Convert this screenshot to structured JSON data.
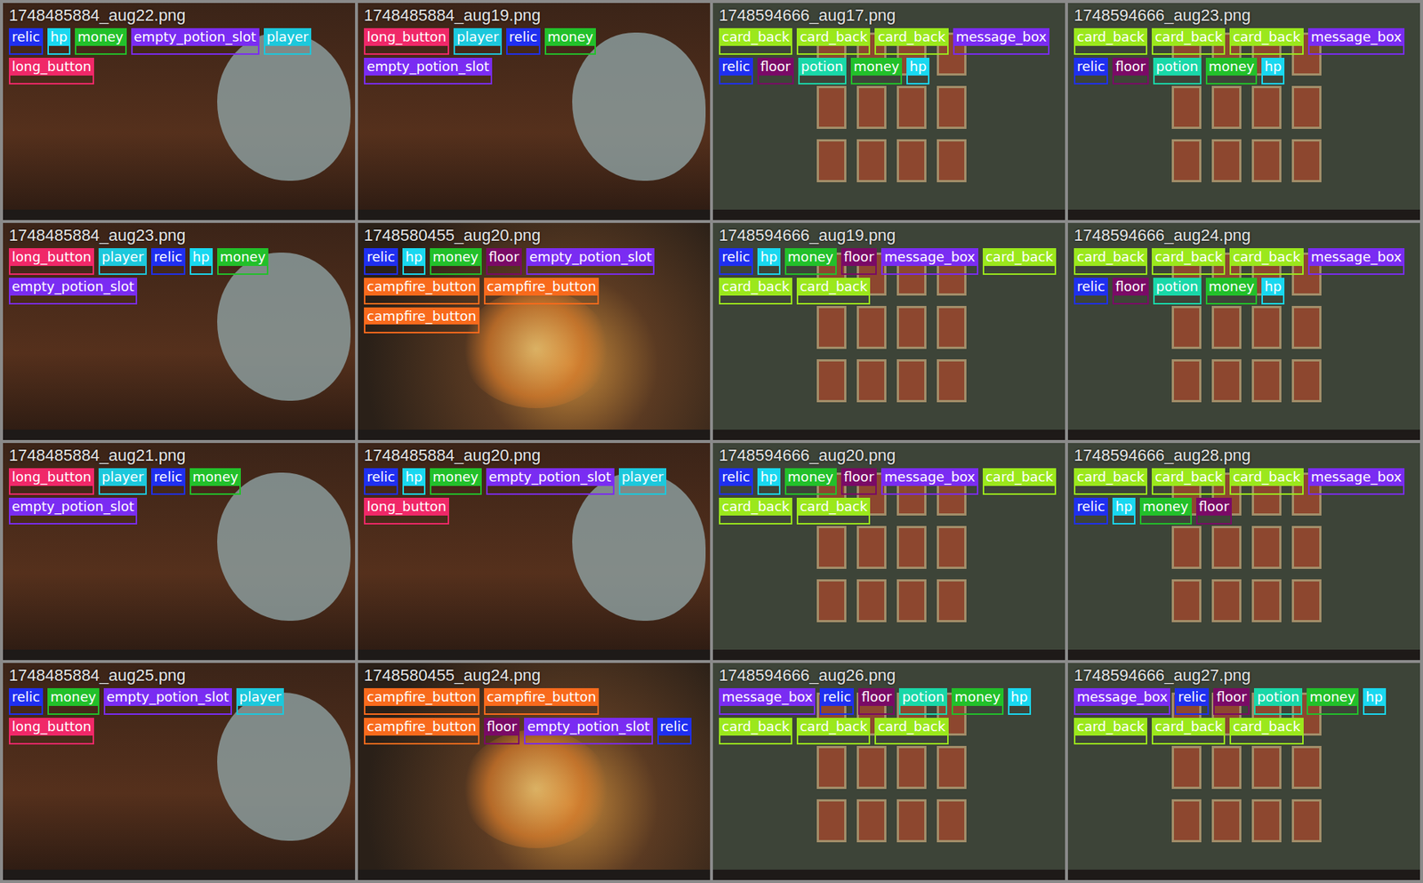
{
  "mosaic": {
    "tiles": [
      {
        "file": "1748485884_aug22.png",
        "kind": "blob",
        "labels": [
          {
            "text": "relic",
            "color": "#1f2ff0"
          },
          {
            "text": "hp",
            "color": "#19d8f0"
          },
          {
            "text": "money",
            "color": "#22c02a"
          },
          {
            "text": "empty_potion_slot",
            "color": "#7a2cf2"
          },
          {
            "text": "player",
            "color": "#1cc8dc"
          },
          {
            "text": "long_button",
            "color": "#f02868"
          }
        ]
      },
      {
        "file": "1748485884_aug19.png",
        "kind": "blob",
        "labels": [
          {
            "text": "long_button",
            "color": "#f02868"
          },
          {
            "text": "player",
            "color": "#1cc8dc"
          },
          {
            "text": "relic",
            "color": "#1f2ff0"
          },
          {
            "text": "money",
            "color": "#22c02a"
          },
          {
            "text": "empty_potion_slot",
            "color": "#7a2cf2"
          }
        ]
      },
      {
        "file": "1748594666_aug17.png",
        "kind": "cards",
        "labels": [
          {
            "text": "card_back",
            "color": "#9be81c"
          },
          {
            "text": "card_back",
            "color": "#9be81c"
          },
          {
            "text": "card_back",
            "color": "#9be81c"
          },
          {
            "text": "message_box",
            "color": "#7a2cf2"
          },
          {
            "text": "relic",
            "color": "#1f2ff0"
          },
          {
            "text": "floor",
            "color": "#7a0a66"
          },
          {
            "text": "potion",
            "color": "#19d8a8"
          },
          {
            "text": "money",
            "color": "#22c02a"
          },
          {
            "text": "hp",
            "color": "#19d8f0"
          }
        ]
      },
      {
        "file": "1748594666_aug23.png",
        "kind": "cards",
        "labels": [
          {
            "text": "card_back",
            "color": "#9be81c"
          },
          {
            "text": "card_back",
            "color": "#9be81c"
          },
          {
            "text": "card_back",
            "color": "#9be81c"
          },
          {
            "text": "message_box",
            "color": "#7a2cf2"
          },
          {
            "text": "relic",
            "color": "#1f2ff0"
          },
          {
            "text": "floor",
            "color": "#7a0a66"
          },
          {
            "text": "potion",
            "color": "#19d8a8"
          },
          {
            "text": "money",
            "color": "#22c02a"
          },
          {
            "text": "hp",
            "color": "#19d8f0"
          }
        ]
      },
      {
        "file": "1748485884_aug23.png",
        "kind": "blob",
        "labels": [
          {
            "text": "long_button",
            "color": "#f02868"
          },
          {
            "text": "player",
            "color": "#1cc8dc"
          },
          {
            "text": "relic",
            "color": "#1f2ff0"
          },
          {
            "text": "hp",
            "color": "#19d8f0"
          },
          {
            "text": "money",
            "color": "#22c02a"
          },
          {
            "text": "empty_potion_slot",
            "color": "#7a2cf2"
          }
        ]
      },
      {
        "file": "1748580455_aug20.png",
        "kind": "campfire",
        "labels": [
          {
            "text": "relic",
            "color": "#1f2ff0"
          },
          {
            "text": "hp",
            "color": "#19d8f0"
          },
          {
            "text": "money",
            "color": "#22c02a"
          },
          {
            "text": "floor",
            "color": "#7a0a66"
          },
          {
            "text": "empty_potion_slot",
            "color": "#7a2cf2"
          },
          {
            "text": "campfire_button",
            "color": "#f86a1c"
          },
          {
            "text": "campfire_button",
            "color": "#f86a1c"
          },
          {
            "text": "campfire_button",
            "color": "#f86a1c"
          }
        ]
      },
      {
        "file": "1748594666_aug19.png",
        "kind": "cards",
        "labels": [
          {
            "text": "relic",
            "color": "#1f2ff0"
          },
          {
            "text": "hp",
            "color": "#19d8f0"
          },
          {
            "text": "money",
            "color": "#22c02a"
          },
          {
            "text": "floor",
            "color": "#7a0a66"
          },
          {
            "text": "message_box",
            "color": "#7a2cf2"
          },
          {
            "text": "card_back",
            "color": "#9be81c"
          },
          {
            "text": "card_back",
            "color": "#9be81c"
          },
          {
            "text": "card_back",
            "color": "#9be81c"
          }
        ]
      },
      {
        "file": "1748594666_aug24.png",
        "kind": "cards",
        "labels": [
          {
            "text": "card_back",
            "color": "#9be81c"
          },
          {
            "text": "card_back",
            "color": "#9be81c"
          },
          {
            "text": "card_back",
            "color": "#9be81c"
          },
          {
            "text": "message_box",
            "color": "#7a2cf2"
          },
          {
            "text": "relic",
            "color": "#1f2ff0"
          },
          {
            "text": "floor",
            "color": "#7a0a66"
          },
          {
            "text": "potion",
            "color": "#19d8a8"
          },
          {
            "text": "money",
            "color": "#22c02a"
          },
          {
            "text": "hp",
            "color": "#19d8f0"
          }
        ]
      },
      {
        "file": "1748485884_aug21.png",
        "kind": "blob",
        "labels": [
          {
            "text": "long_button",
            "color": "#f02868"
          },
          {
            "text": "player",
            "color": "#1cc8dc"
          },
          {
            "text": "relic",
            "color": "#1f2ff0"
          },
          {
            "text": "money",
            "color": "#22c02a"
          },
          {
            "text": "empty_potion_slot",
            "color": "#7a2cf2"
          }
        ]
      },
      {
        "file": "1748485884_aug20.png",
        "kind": "blob",
        "labels": [
          {
            "text": "relic",
            "color": "#1f2ff0"
          },
          {
            "text": "hp",
            "color": "#19d8f0"
          },
          {
            "text": "money",
            "color": "#22c02a"
          },
          {
            "text": "empty_potion_slot",
            "color": "#7a2cf2"
          },
          {
            "text": "player",
            "color": "#1cc8dc"
          },
          {
            "text": "long_button",
            "color": "#f02868"
          }
        ]
      },
      {
        "file": "1748594666_aug20.png",
        "kind": "cards",
        "labels": [
          {
            "text": "relic",
            "color": "#1f2ff0"
          },
          {
            "text": "hp",
            "color": "#19d8f0"
          },
          {
            "text": "money",
            "color": "#22c02a"
          },
          {
            "text": "floor",
            "color": "#7a0a66"
          },
          {
            "text": "message_box",
            "color": "#7a2cf2"
          },
          {
            "text": "card_back",
            "color": "#9be81c"
          },
          {
            "text": "card_back",
            "color": "#9be81c"
          },
          {
            "text": "card_back",
            "color": "#9be81c"
          }
        ]
      },
      {
        "file": "1748594666_aug28.png",
        "kind": "cards",
        "labels": [
          {
            "text": "card_back",
            "color": "#9be81c"
          },
          {
            "text": "card_back",
            "color": "#9be81c"
          },
          {
            "text": "card_back",
            "color": "#9be81c"
          },
          {
            "text": "message_box",
            "color": "#7a2cf2"
          },
          {
            "text": "relic",
            "color": "#1f2ff0"
          },
          {
            "text": "hp",
            "color": "#19d8f0"
          },
          {
            "text": "money",
            "color": "#22c02a"
          },
          {
            "text": "floor",
            "color": "#7a0a66"
          }
        ]
      },
      {
        "file": "1748485884_aug25.png",
        "kind": "blob",
        "labels": [
          {
            "text": "relic",
            "color": "#1f2ff0"
          },
          {
            "text": "money",
            "color": "#22c02a"
          },
          {
            "text": "empty_potion_slot",
            "color": "#7a2cf2"
          },
          {
            "text": "player",
            "color": "#1cc8dc"
          },
          {
            "text": "long_button",
            "color": "#f02868"
          }
        ]
      },
      {
        "file": "1748580455_aug24.png",
        "kind": "campfire",
        "labels": [
          {
            "text": "campfire_button",
            "color": "#f86a1c"
          },
          {
            "text": "campfire_button",
            "color": "#f86a1c"
          },
          {
            "text": "campfire_button",
            "color": "#f86a1c"
          },
          {
            "text": "floor",
            "color": "#7a0a66"
          },
          {
            "text": "empty_potion_slot",
            "color": "#7a2cf2"
          },
          {
            "text": "relic",
            "color": "#1f2ff0"
          }
        ]
      },
      {
        "file": "1748594666_aug26.png",
        "kind": "cards",
        "labels": [
          {
            "text": "message_box",
            "color": "#7a2cf2"
          },
          {
            "text": "relic",
            "color": "#1f2ff0"
          },
          {
            "text": "floor",
            "color": "#7a0a66"
          },
          {
            "text": "potion",
            "color": "#19d8a8"
          },
          {
            "text": "money",
            "color": "#22c02a"
          },
          {
            "text": "hp",
            "color": "#19d8f0"
          },
          {
            "text": "card_back",
            "color": "#9be81c"
          },
          {
            "text": "card_back",
            "color": "#9be81c"
          },
          {
            "text": "card_back",
            "color": "#9be81c"
          }
        ]
      },
      {
        "file": "1748594666_aug27.png",
        "kind": "cards",
        "labels": [
          {
            "text": "message_box",
            "color": "#7a2cf2"
          },
          {
            "text": "relic",
            "color": "#1f2ff0"
          },
          {
            "text": "floor",
            "color": "#7a0a66"
          },
          {
            "text": "potion",
            "color": "#19d8a8"
          },
          {
            "text": "money",
            "color": "#22c02a"
          },
          {
            "text": "hp",
            "color": "#19d8f0"
          },
          {
            "text": "card_back",
            "color": "#9be81c"
          },
          {
            "text": "card_back",
            "color": "#9be81c"
          },
          {
            "text": "card_back",
            "color": "#9be81c"
          }
        ]
      }
    ]
  }
}
